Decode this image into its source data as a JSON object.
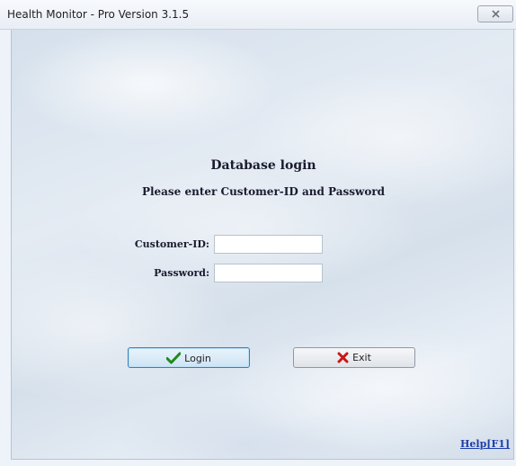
{
  "window": {
    "title": "Health Monitor - Pro Version 3.1.5",
    "close_icon": "close-icon"
  },
  "login": {
    "heading": "Database login",
    "subheading": "Please enter Customer-ID and Password",
    "customer_id_label": "Customer-ID:",
    "customer_id_value": "",
    "password_label": "Password:",
    "password_value": ""
  },
  "buttons": {
    "login_label": "Login",
    "login_icon": "checkmark-icon",
    "exit_label": "Exit",
    "exit_icon": "x-icon"
  },
  "help": {
    "label": "Help[F1]"
  },
  "colors": {
    "checkmark": "#1f8a1f",
    "exit_x": "#c81818",
    "help_link": "#1f3fa8"
  }
}
